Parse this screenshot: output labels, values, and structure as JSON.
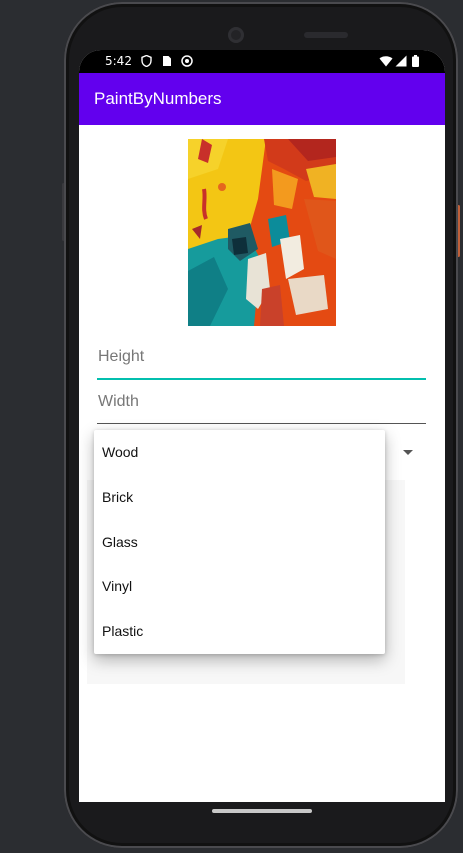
{
  "status_bar": {
    "time": "5:42",
    "left_icons": [
      "shield-icon",
      "sim-card-icon",
      "notification-icon"
    ],
    "right_icons": [
      "wifi-icon",
      "signal-icon",
      "battery-icon"
    ]
  },
  "app_bar": {
    "title": "PaintByNumbers",
    "color": "#6200ee"
  },
  "painting": {
    "icon": "abstract-painting-image"
  },
  "form": {
    "height_placeholder": "Height",
    "width_placeholder": "Width",
    "focus_color": "#03bfae"
  },
  "material_dropdown": {
    "options": [
      "Wood",
      "Brick",
      "Glass",
      "Vinyl",
      "Plastic"
    ]
  }
}
